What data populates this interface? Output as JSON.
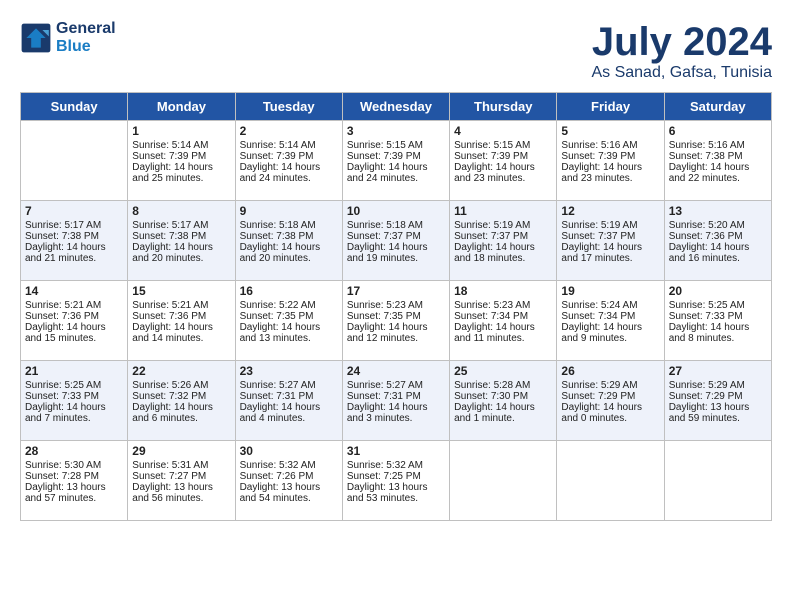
{
  "logo": {
    "line1": "General",
    "line2": "Blue"
  },
  "title": "July 2024",
  "location": "As Sanad, Gafsa, Tunisia",
  "weekdays": [
    "Sunday",
    "Monday",
    "Tuesday",
    "Wednesday",
    "Thursday",
    "Friday",
    "Saturday"
  ],
  "weeks": [
    [
      {
        "day": "",
        "info": ""
      },
      {
        "day": "1",
        "info": "Sunrise: 5:14 AM\nSunset: 7:39 PM\nDaylight: 14 hours\nand 25 minutes."
      },
      {
        "day": "2",
        "info": "Sunrise: 5:14 AM\nSunset: 7:39 PM\nDaylight: 14 hours\nand 24 minutes."
      },
      {
        "day": "3",
        "info": "Sunrise: 5:15 AM\nSunset: 7:39 PM\nDaylight: 14 hours\nand 24 minutes."
      },
      {
        "day": "4",
        "info": "Sunrise: 5:15 AM\nSunset: 7:39 PM\nDaylight: 14 hours\nand 23 minutes."
      },
      {
        "day": "5",
        "info": "Sunrise: 5:16 AM\nSunset: 7:39 PM\nDaylight: 14 hours\nand 23 minutes."
      },
      {
        "day": "6",
        "info": "Sunrise: 5:16 AM\nSunset: 7:38 PM\nDaylight: 14 hours\nand 22 minutes."
      }
    ],
    [
      {
        "day": "7",
        "info": "Sunrise: 5:17 AM\nSunset: 7:38 PM\nDaylight: 14 hours\nand 21 minutes."
      },
      {
        "day": "8",
        "info": "Sunrise: 5:17 AM\nSunset: 7:38 PM\nDaylight: 14 hours\nand 20 minutes."
      },
      {
        "day": "9",
        "info": "Sunrise: 5:18 AM\nSunset: 7:38 PM\nDaylight: 14 hours\nand 20 minutes."
      },
      {
        "day": "10",
        "info": "Sunrise: 5:18 AM\nSunset: 7:37 PM\nDaylight: 14 hours\nand 19 minutes."
      },
      {
        "day": "11",
        "info": "Sunrise: 5:19 AM\nSunset: 7:37 PM\nDaylight: 14 hours\nand 18 minutes."
      },
      {
        "day": "12",
        "info": "Sunrise: 5:19 AM\nSunset: 7:37 PM\nDaylight: 14 hours\nand 17 minutes."
      },
      {
        "day": "13",
        "info": "Sunrise: 5:20 AM\nSunset: 7:36 PM\nDaylight: 14 hours\nand 16 minutes."
      }
    ],
    [
      {
        "day": "14",
        "info": "Sunrise: 5:21 AM\nSunset: 7:36 PM\nDaylight: 14 hours\nand 15 minutes."
      },
      {
        "day": "15",
        "info": "Sunrise: 5:21 AM\nSunset: 7:36 PM\nDaylight: 14 hours\nand 14 minutes."
      },
      {
        "day": "16",
        "info": "Sunrise: 5:22 AM\nSunset: 7:35 PM\nDaylight: 14 hours\nand 13 minutes."
      },
      {
        "day": "17",
        "info": "Sunrise: 5:23 AM\nSunset: 7:35 PM\nDaylight: 14 hours\nand 12 minutes."
      },
      {
        "day": "18",
        "info": "Sunrise: 5:23 AM\nSunset: 7:34 PM\nDaylight: 14 hours\nand 11 minutes."
      },
      {
        "day": "19",
        "info": "Sunrise: 5:24 AM\nSunset: 7:34 PM\nDaylight: 14 hours\nand 9 minutes."
      },
      {
        "day": "20",
        "info": "Sunrise: 5:25 AM\nSunset: 7:33 PM\nDaylight: 14 hours\nand 8 minutes."
      }
    ],
    [
      {
        "day": "21",
        "info": "Sunrise: 5:25 AM\nSunset: 7:33 PM\nDaylight: 14 hours\nand 7 minutes."
      },
      {
        "day": "22",
        "info": "Sunrise: 5:26 AM\nSunset: 7:32 PM\nDaylight: 14 hours\nand 6 minutes."
      },
      {
        "day": "23",
        "info": "Sunrise: 5:27 AM\nSunset: 7:31 PM\nDaylight: 14 hours\nand 4 minutes."
      },
      {
        "day": "24",
        "info": "Sunrise: 5:27 AM\nSunset: 7:31 PM\nDaylight: 14 hours\nand 3 minutes."
      },
      {
        "day": "25",
        "info": "Sunrise: 5:28 AM\nSunset: 7:30 PM\nDaylight: 14 hours\nand 1 minute."
      },
      {
        "day": "26",
        "info": "Sunrise: 5:29 AM\nSunset: 7:29 PM\nDaylight: 14 hours\nand 0 minutes."
      },
      {
        "day": "27",
        "info": "Sunrise: 5:29 AM\nSunset: 7:29 PM\nDaylight: 13 hours\nand 59 minutes."
      }
    ],
    [
      {
        "day": "28",
        "info": "Sunrise: 5:30 AM\nSunset: 7:28 PM\nDaylight: 13 hours\nand 57 minutes."
      },
      {
        "day": "29",
        "info": "Sunrise: 5:31 AM\nSunset: 7:27 PM\nDaylight: 13 hours\nand 56 minutes."
      },
      {
        "day": "30",
        "info": "Sunrise: 5:32 AM\nSunset: 7:26 PM\nDaylight: 13 hours\nand 54 minutes."
      },
      {
        "day": "31",
        "info": "Sunrise: 5:32 AM\nSunset: 7:25 PM\nDaylight: 13 hours\nand 53 minutes."
      },
      {
        "day": "",
        "info": ""
      },
      {
        "day": "",
        "info": ""
      },
      {
        "day": "",
        "info": ""
      }
    ]
  ]
}
